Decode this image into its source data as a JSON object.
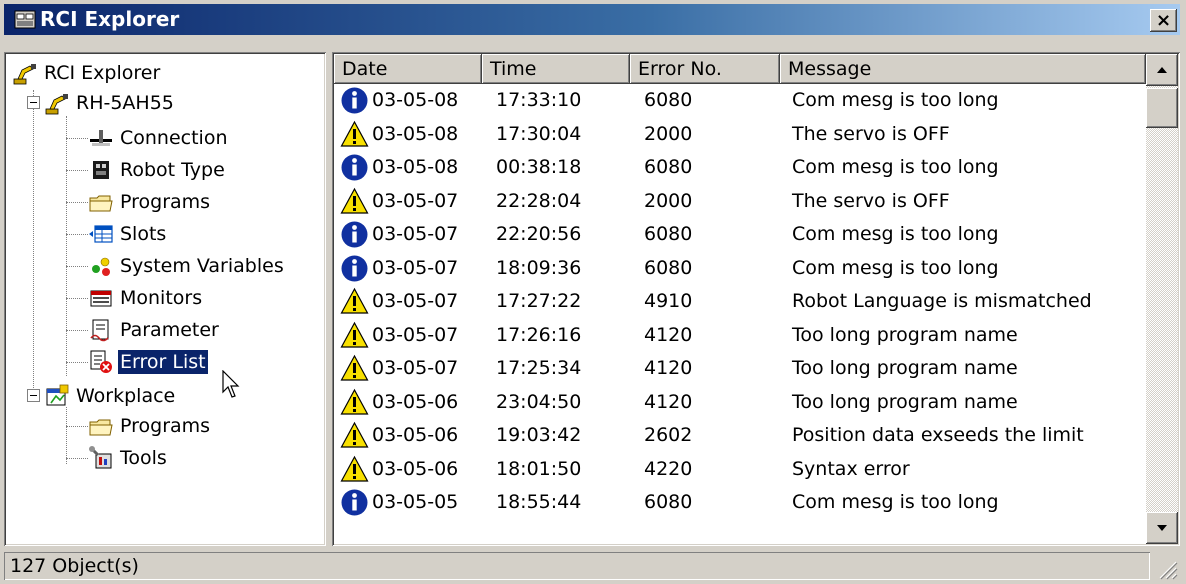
{
  "window": {
    "title": "RCI Explorer",
    "close_label": "×"
  },
  "tree": {
    "root": "RCI Explorer",
    "robot": "RH-5AH55",
    "robot_children": [
      "Connection",
      "Robot Type",
      "Programs",
      "Slots",
      "System Variables",
      "Monitors",
      "Parameter",
      "Error List"
    ],
    "workplace": "Workplace",
    "workplace_children": [
      "Programs",
      "Tools"
    ],
    "selected": "Error List"
  },
  "list": {
    "columns": [
      "Date",
      "Time",
      "Error No.",
      "Message"
    ],
    "rows": [
      {
        "icon": "info-icon",
        "date": "03-05-08",
        "time": "17:33:10",
        "error_no": "6080",
        "message": "Com mesg is too long"
      },
      {
        "icon": "warning-icon",
        "date": "03-05-08",
        "time": "17:30:04",
        "error_no": "2000",
        "message": "The servo is OFF"
      },
      {
        "icon": "info-icon",
        "date": "03-05-08",
        "time": "00:38:18",
        "error_no": "6080",
        "message": "Com mesg is too long"
      },
      {
        "icon": "warning-icon",
        "date": "03-05-07",
        "time": "22:28:04",
        "error_no": "2000",
        "message": "The servo is OFF"
      },
      {
        "icon": "info-icon",
        "date": "03-05-07",
        "time": "22:20:56",
        "error_no": "6080",
        "message": "Com mesg is too long"
      },
      {
        "icon": "info-icon",
        "date": "03-05-07",
        "time": "18:09:36",
        "error_no": "6080",
        "message": "Com mesg is too long"
      },
      {
        "icon": "warning-icon",
        "date": "03-05-07",
        "time": "17:27:22",
        "error_no": "4910",
        "message": "Robot Language is mismatched"
      },
      {
        "icon": "warning-icon",
        "date": "03-05-07",
        "time": "17:26:16",
        "error_no": "4120",
        "message": "Too long program name"
      },
      {
        "icon": "warning-icon",
        "date": "03-05-07",
        "time": "17:25:34",
        "error_no": "4120",
        "message": "Too long program name"
      },
      {
        "icon": "warning-icon",
        "date": "03-05-06",
        "time": "23:04:50",
        "error_no": "4120",
        "message": "Too long program name"
      },
      {
        "icon": "warning-icon",
        "date": "03-05-06",
        "time": "19:03:42",
        "error_no": "2602",
        "message": "Position data exseeds the limit"
      },
      {
        "icon": "warning-icon",
        "date": "03-05-06",
        "time": "18:01:50",
        "error_no": "4220",
        "message": "Syntax error"
      },
      {
        "icon": "info-icon",
        "date": "03-05-05",
        "time": "18:55:44",
        "error_no": "6080",
        "message": "Com mesg is too long"
      }
    ]
  },
  "status": {
    "text": "127 Object(s)"
  },
  "colors": {
    "title_start": "#0a246a",
    "title_end": "#a6caf0",
    "selection": "#0a246a",
    "face": "#d4d0c8"
  }
}
